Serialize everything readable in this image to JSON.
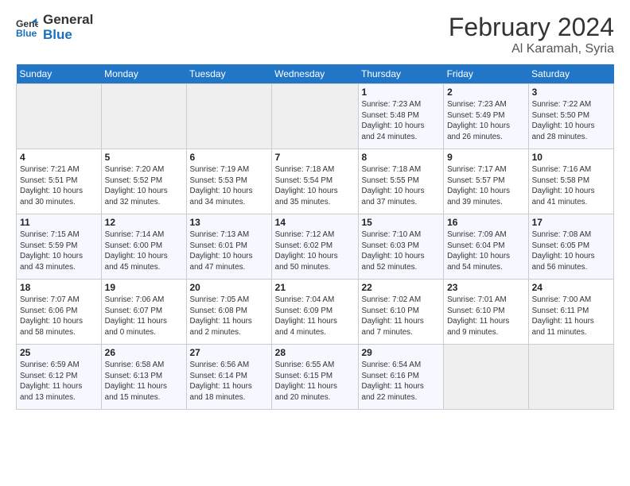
{
  "header": {
    "logo_line1": "General",
    "logo_line2": "Blue",
    "month": "February 2024",
    "location": "Al Karamah, Syria"
  },
  "days_of_week": [
    "Sunday",
    "Monday",
    "Tuesday",
    "Wednesday",
    "Thursday",
    "Friday",
    "Saturday"
  ],
  "weeks": [
    [
      {
        "day": "",
        "detail": ""
      },
      {
        "day": "",
        "detail": ""
      },
      {
        "day": "",
        "detail": ""
      },
      {
        "day": "",
        "detail": ""
      },
      {
        "day": "1",
        "detail": "Sunrise: 7:23 AM\nSunset: 5:48 PM\nDaylight: 10 hours\nand 24 minutes."
      },
      {
        "day": "2",
        "detail": "Sunrise: 7:23 AM\nSunset: 5:49 PM\nDaylight: 10 hours\nand 26 minutes."
      },
      {
        "day": "3",
        "detail": "Sunrise: 7:22 AM\nSunset: 5:50 PM\nDaylight: 10 hours\nand 28 minutes."
      }
    ],
    [
      {
        "day": "4",
        "detail": "Sunrise: 7:21 AM\nSunset: 5:51 PM\nDaylight: 10 hours\nand 30 minutes."
      },
      {
        "day": "5",
        "detail": "Sunrise: 7:20 AM\nSunset: 5:52 PM\nDaylight: 10 hours\nand 32 minutes."
      },
      {
        "day": "6",
        "detail": "Sunrise: 7:19 AM\nSunset: 5:53 PM\nDaylight: 10 hours\nand 34 minutes."
      },
      {
        "day": "7",
        "detail": "Sunrise: 7:18 AM\nSunset: 5:54 PM\nDaylight: 10 hours\nand 35 minutes."
      },
      {
        "day": "8",
        "detail": "Sunrise: 7:18 AM\nSunset: 5:55 PM\nDaylight: 10 hours\nand 37 minutes."
      },
      {
        "day": "9",
        "detail": "Sunrise: 7:17 AM\nSunset: 5:57 PM\nDaylight: 10 hours\nand 39 minutes."
      },
      {
        "day": "10",
        "detail": "Sunrise: 7:16 AM\nSunset: 5:58 PM\nDaylight: 10 hours\nand 41 minutes."
      }
    ],
    [
      {
        "day": "11",
        "detail": "Sunrise: 7:15 AM\nSunset: 5:59 PM\nDaylight: 10 hours\nand 43 minutes."
      },
      {
        "day": "12",
        "detail": "Sunrise: 7:14 AM\nSunset: 6:00 PM\nDaylight: 10 hours\nand 45 minutes."
      },
      {
        "day": "13",
        "detail": "Sunrise: 7:13 AM\nSunset: 6:01 PM\nDaylight: 10 hours\nand 47 minutes."
      },
      {
        "day": "14",
        "detail": "Sunrise: 7:12 AM\nSunset: 6:02 PM\nDaylight: 10 hours\nand 50 minutes."
      },
      {
        "day": "15",
        "detail": "Sunrise: 7:10 AM\nSunset: 6:03 PM\nDaylight: 10 hours\nand 52 minutes."
      },
      {
        "day": "16",
        "detail": "Sunrise: 7:09 AM\nSunset: 6:04 PM\nDaylight: 10 hours\nand 54 minutes."
      },
      {
        "day": "17",
        "detail": "Sunrise: 7:08 AM\nSunset: 6:05 PM\nDaylight: 10 hours\nand 56 minutes."
      }
    ],
    [
      {
        "day": "18",
        "detail": "Sunrise: 7:07 AM\nSunset: 6:06 PM\nDaylight: 10 hours\nand 58 minutes."
      },
      {
        "day": "19",
        "detail": "Sunrise: 7:06 AM\nSunset: 6:07 PM\nDaylight: 11 hours\nand 0 minutes."
      },
      {
        "day": "20",
        "detail": "Sunrise: 7:05 AM\nSunset: 6:08 PM\nDaylight: 11 hours\nand 2 minutes."
      },
      {
        "day": "21",
        "detail": "Sunrise: 7:04 AM\nSunset: 6:09 PM\nDaylight: 11 hours\nand 4 minutes."
      },
      {
        "day": "22",
        "detail": "Sunrise: 7:02 AM\nSunset: 6:10 PM\nDaylight: 11 hours\nand 7 minutes."
      },
      {
        "day": "23",
        "detail": "Sunrise: 7:01 AM\nSunset: 6:10 PM\nDaylight: 11 hours\nand 9 minutes."
      },
      {
        "day": "24",
        "detail": "Sunrise: 7:00 AM\nSunset: 6:11 PM\nDaylight: 11 hours\nand 11 minutes."
      }
    ],
    [
      {
        "day": "25",
        "detail": "Sunrise: 6:59 AM\nSunset: 6:12 PM\nDaylight: 11 hours\nand 13 minutes."
      },
      {
        "day": "26",
        "detail": "Sunrise: 6:58 AM\nSunset: 6:13 PM\nDaylight: 11 hours\nand 15 minutes."
      },
      {
        "day": "27",
        "detail": "Sunrise: 6:56 AM\nSunset: 6:14 PM\nDaylight: 11 hours\nand 18 minutes."
      },
      {
        "day": "28",
        "detail": "Sunrise: 6:55 AM\nSunset: 6:15 PM\nDaylight: 11 hours\nand 20 minutes."
      },
      {
        "day": "29",
        "detail": "Sunrise: 6:54 AM\nSunset: 6:16 PM\nDaylight: 11 hours\nand 22 minutes."
      },
      {
        "day": "",
        "detail": ""
      },
      {
        "day": "",
        "detail": ""
      }
    ]
  ]
}
